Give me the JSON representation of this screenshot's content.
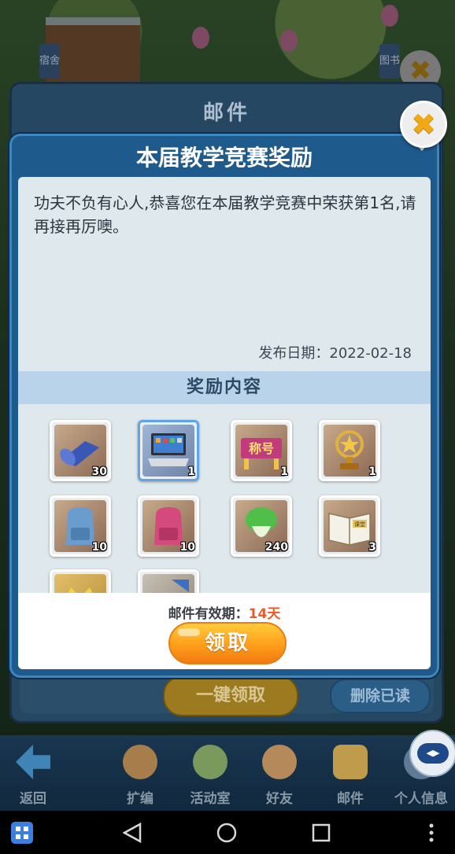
{
  "back_panel": {
    "title": "邮件",
    "claim_all_label": "一键领取",
    "delete_read_label": "删除已读"
  },
  "dialog": {
    "title": "本届教学竞赛奖励",
    "message": "功夫不负有心人,恭喜您在本届教学竞赛中荣获第1名,请再接再厉噢。",
    "date_label": "发布日期：",
    "date_value": "2022-02-18",
    "rewards_header": "奖励内容",
    "items": [
      {
        "name": "blue-mat",
        "count": "30"
      },
      {
        "name": "laptop",
        "count": "1"
      },
      {
        "name": "title-sign",
        "count": "1",
        "label": "称号"
      },
      {
        "name": "star-trophy",
        "count": "1"
      },
      {
        "name": "blue-backpack",
        "count": "10"
      },
      {
        "name": "pink-backpack",
        "count": "10"
      },
      {
        "name": "bok-choy",
        "count": "240"
      },
      {
        "name": "lesson-book",
        "count": "3",
        "label": "课堂"
      },
      {
        "name": "crown-item",
        "count": ""
      },
      {
        "name": "blue-item",
        "count": ""
      }
    ],
    "validity_label": "邮件有效期：",
    "validity_days": "14天",
    "claim_label": "领取"
  },
  "bg": {
    "sign_left": "宿舍",
    "sign_right": "图书"
  },
  "game_nav": [
    {
      "label": "返回",
      "icon": "back-arrow-icon"
    },
    {
      "label": "扩编",
      "icon": "expand-staff-icon"
    },
    {
      "label": "活动室",
      "icon": "activity-room-icon"
    },
    {
      "label": "好友",
      "icon": "friends-icon"
    },
    {
      "label": "邮件",
      "icon": "mail-icon"
    },
    {
      "label": "个人信息",
      "icon": "profile-icon"
    }
  ],
  "colors": {
    "accent_orange": "#ff9d1a",
    "dialog_blue": "#1f5a8c",
    "days_red": "#ea5b2a"
  }
}
